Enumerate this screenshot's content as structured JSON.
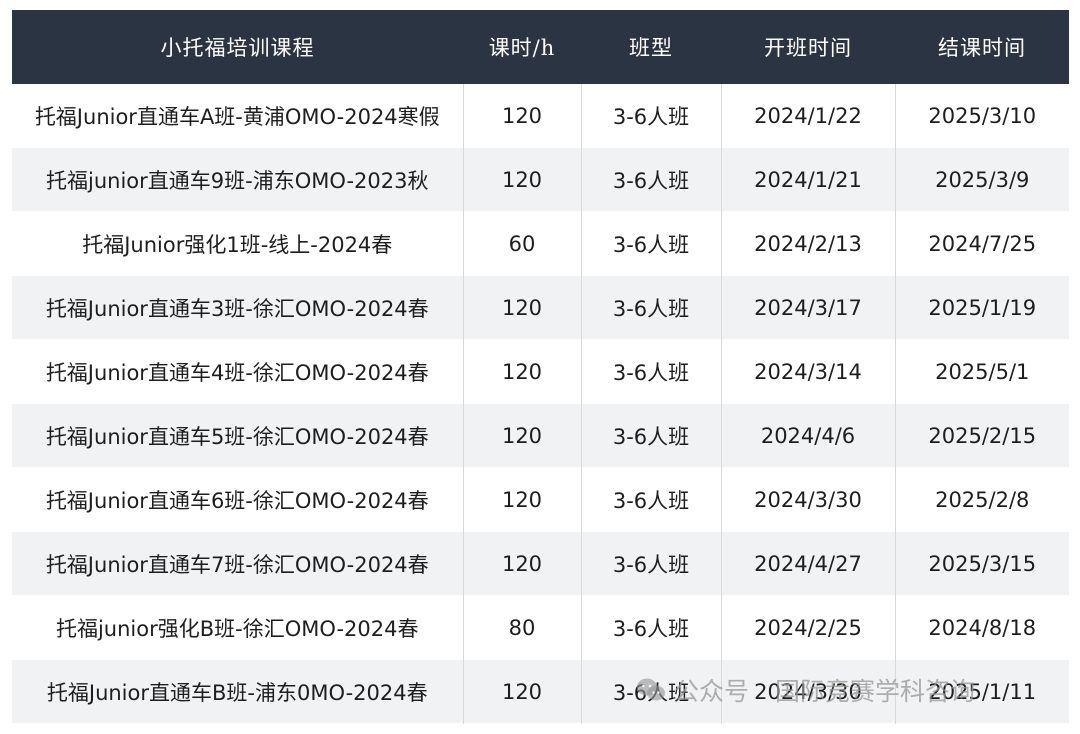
{
  "table": {
    "headers": [
      "小托福培训课程",
      "课时/h",
      "班型",
      "开班时间",
      "结课时间"
    ],
    "rows": [
      [
        "托福Junior直通车A班-黄浦OMO-2024寒假",
        "120",
        "3-6人班",
        "2024/1/22",
        "2025/3/10"
      ],
      [
        "托福junior直通车9班-浦东OMO-2023秋",
        "120",
        "3-6人班",
        "2024/1/21",
        "2025/3/9"
      ],
      [
        "托福Junior强化1班-线上-2024春",
        "60",
        "3-6人班",
        "2024/2/13",
        "2024/7/25"
      ],
      [
        "托福Junior直通车3班-徐汇OMO-2024春",
        "120",
        "3-6人班",
        "2024/3/17",
        "2025/1/19"
      ],
      [
        "托福Junior直通车4班-徐汇OMO-2024春",
        "120",
        "3-6人班",
        "2024/3/14",
        "2025/5/1"
      ],
      [
        "托福Junior直通车5班-徐汇OMO-2024春",
        "120",
        "3-6人班",
        "2024/4/6",
        "2025/2/15"
      ],
      [
        "托福Junior直通车6班-徐汇OMO-2024春",
        "120",
        "3-6人班",
        "2024/3/30",
        "2025/2/8"
      ],
      [
        "托福Junior直通车7班-徐汇OMO-2024春",
        "120",
        "3-6人班",
        "2024/4/27",
        "2025/3/15"
      ],
      [
        "托福junior强化B班-徐汇OMO-2024春",
        "80",
        "3-6人班",
        "2024/2/25",
        "2024/8/18"
      ],
      [
        "托福Junior直通车B班-浦东0MO-2024春",
        "120",
        "3-6人班",
        "2024/3/30",
        "2025/1/11"
      ]
    ]
  },
  "watermark": {
    "prefix": "公众号",
    "name": "国际竞赛学科咨询",
    "icon": "wechat-icon"
  },
  "colors": {
    "header_bg": "#2a3442",
    "header_text": "#ffffff",
    "stripe": "#f1f2f4"
  }
}
